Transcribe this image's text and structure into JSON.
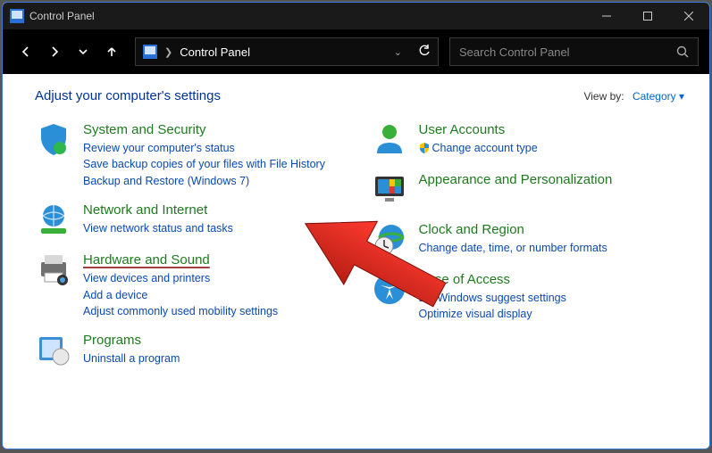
{
  "window": {
    "title": "Control Panel"
  },
  "nav": {
    "address_text": "Control Panel",
    "search_placeholder": "Search Control Panel"
  },
  "header": {
    "title": "Adjust your computer's settings",
    "viewby_label": "View by:",
    "viewby_value": "Category"
  },
  "left": [
    {
      "title": "System and Security",
      "links": [
        "Review your computer's status",
        "Save backup copies of your files with File History",
        "Backup and Restore (Windows 7)"
      ]
    },
    {
      "title": "Network and Internet",
      "links": [
        "View network status and tasks"
      ]
    },
    {
      "title": "Hardware and Sound",
      "highlighted": true,
      "links": [
        "View devices and printers",
        "Add a device",
        "Adjust commonly used mobility settings"
      ]
    },
    {
      "title": "Programs",
      "links": [
        "Uninstall a program"
      ]
    }
  ],
  "right": [
    {
      "title": "User Accounts",
      "links": [
        "Change account type"
      ],
      "shield": [
        true
      ]
    },
    {
      "title": "Appearance and Personalization",
      "links": []
    },
    {
      "title": "Clock and Region",
      "links": [
        "Change date, time, or number formats"
      ]
    },
    {
      "title": "Ease of Access",
      "links": [
        "Let Windows suggest settings",
        "Optimize visual display"
      ]
    }
  ]
}
